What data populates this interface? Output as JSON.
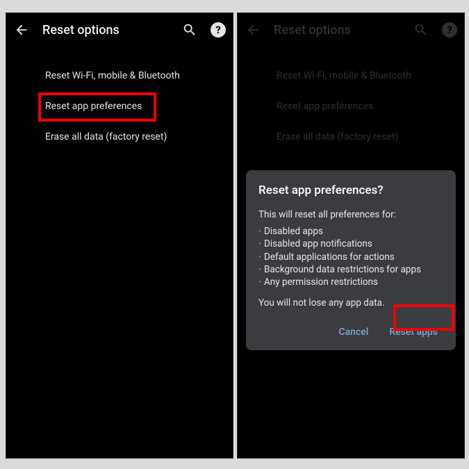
{
  "appbar": {
    "title": "Reset options"
  },
  "options": [
    {
      "label": "Reset Wi-Fi, mobile & Bluetooth"
    },
    {
      "label": "Reset app preferences"
    },
    {
      "label": "Erase all data (factory reset)"
    }
  ],
  "dialog": {
    "title": "Reset app preferences?",
    "intro": "This will reset all preferences for:",
    "bullets": [
      "Disabled apps",
      "Disabled app notifications",
      "Default applications for actions",
      "Background data restrictions for apps",
      "Any permission restrictions"
    ],
    "note": "You will not lose any app data.",
    "cancel": "Cancel",
    "confirm": "Reset apps"
  }
}
